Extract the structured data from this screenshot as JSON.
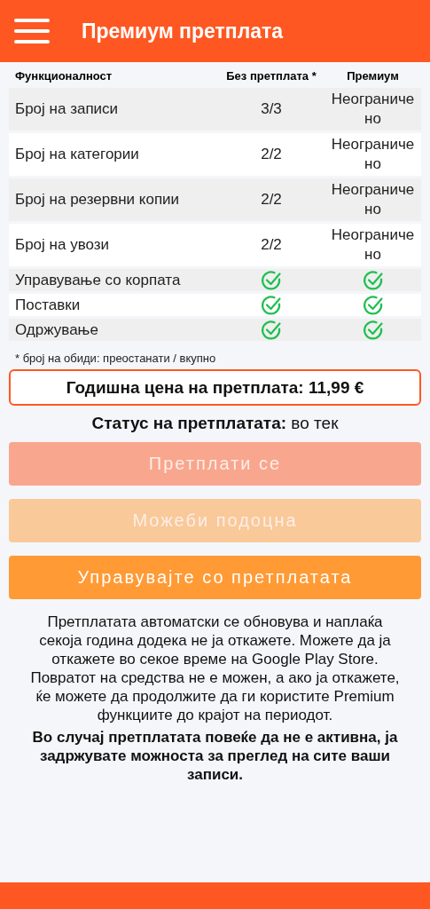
{
  "app_bar": {
    "title": "Премиум претплата"
  },
  "table": {
    "columns": [
      "Функционалност",
      "Без претплата *",
      "Премиум"
    ],
    "rows": [
      {
        "kind": "count",
        "feature": "Број на записи",
        "free": "3/3",
        "premium": "Неограничено"
      },
      {
        "kind": "count",
        "feature": "Број на категории",
        "free": "2/2",
        "premium": "Неограничено"
      },
      {
        "kind": "count",
        "feature": "Број на резервни копии",
        "free": "2/2",
        "premium": "Неограничено"
      },
      {
        "kind": "count",
        "feature": "Број на увози",
        "free": "2/2",
        "premium": "Неограничено"
      },
      {
        "kind": "check",
        "feature": "Управување со корпата",
        "free": true,
        "premium": true
      },
      {
        "kind": "check",
        "feature": "Поставки",
        "free": true,
        "premium": true
      },
      {
        "kind": "check",
        "feature": "Одржување",
        "free": true,
        "premium": true
      }
    ]
  },
  "footnote": "* број на обиди: преостанати / вкупно",
  "price": "Годишна цена на претплата: 11,99 €",
  "status": "**Статус на претплатата:** во тек",
  "buttons": [
    {
      "label": "Претплати се",
      "disabled": true,
      "color": "#f9a68e"
    },
    {
      "label": "Можеби подоцна",
      "disabled": true,
      "color": "#f9c99a"
    },
    {
      "label": "Управувајте со претплатата",
      "disabled": false,
      "color": "#ff9a35"
    }
  ],
  "info": "Претплатата автоматски се обновува и наплаќа секоја година додека не ја откажете. Можете да ја откажете во секое време на Google Play Store. Повратот на средства не е можен, а ако ја откажете, ќе можете да продолжите да ги користите Premium функциите до крајот на периодот.",
  "note": "Во случај претплатата повеќе да не е активна, ја задржувате можноста за преглед на сите ваши записи."
}
